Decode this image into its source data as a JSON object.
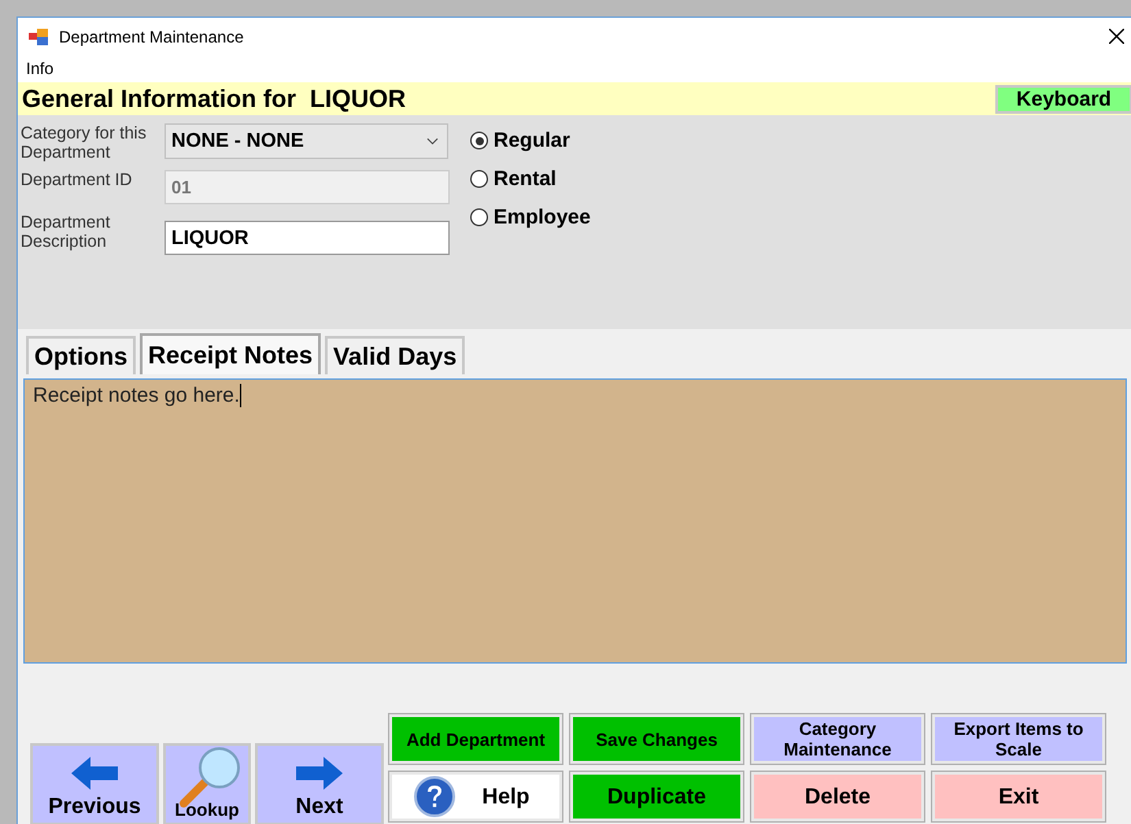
{
  "window": {
    "title": "Department Maintenance"
  },
  "menu": [
    "Info"
  ],
  "header": {
    "title": "General Information for  LIQUOR",
    "keyboard_button": "Keyboard"
  },
  "fields": [
    {
      "kind": "dropdown",
      "label": "Category for this Department",
      "value": "NONE - NONE",
      "disabled": false
    },
    {
      "kind": "text",
      "label": "Department ID",
      "value": "01",
      "disabled": true
    },
    {
      "kind": "text",
      "label": "Department Description",
      "value": "LIQUOR",
      "disabled": false
    }
  ],
  "department_types": [
    {
      "label": "Regular",
      "selected": true
    },
    {
      "label": "Rental",
      "selected": false
    },
    {
      "label": "Employee",
      "selected": false
    }
  ],
  "tabs": [
    {
      "label": "Options",
      "selected": false
    },
    {
      "label": "Receipt Notes",
      "selected": true
    },
    {
      "label": "Valid Days",
      "selected": false
    }
  ],
  "receipt_notes": {
    "value": "Receipt notes go here."
  },
  "nav_buttons": [
    {
      "kind": "previous",
      "label": "Previous"
    },
    {
      "kind": "lookup",
      "label": "Lookup"
    },
    {
      "kind": "next",
      "label": "Next"
    }
  ],
  "action_buttons": [
    {
      "label": "Add Department",
      "color": "#00c000",
      "kind": "text"
    },
    {
      "label": "Save Changes",
      "color": "#00c000",
      "kind": "text"
    },
    {
      "label": "Category Maintenance",
      "color": "#c0c0ff",
      "kind": "text"
    },
    {
      "label": "Export Items to Scale",
      "color": "#c0c0ff",
      "kind": "text"
    },
    {
      "label": "Help",
      "color": "#ffffff",
      "kind": "help"
    },
    {
      "label": "Duplicate",
      "color": "#00c000",
      "kind": "text"
    },
    {
      "label": "Delete",
      "color": "#ffc0c0",
      "kind": "text"
    },
    {
      "label": "Exit",
      "color": "#ffc0c0",
      "kind": "text"
    }
  ]
}
